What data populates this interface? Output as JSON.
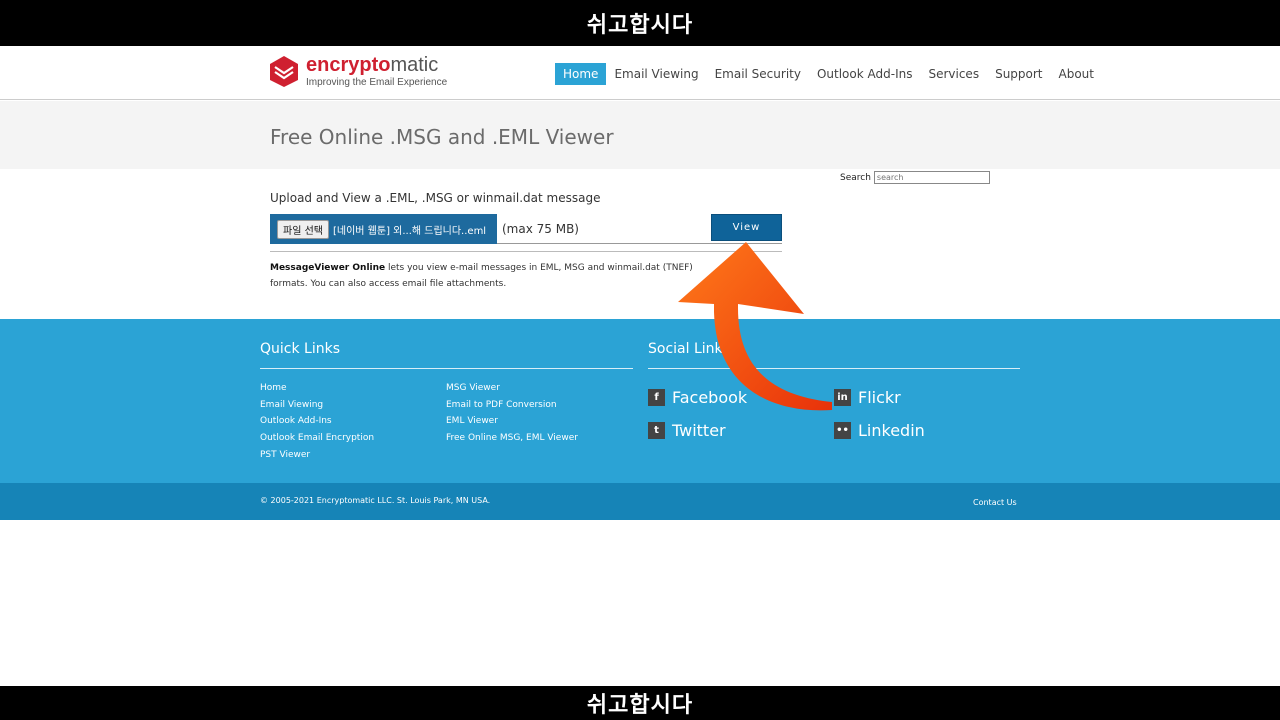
{
  "overlay": {
    "top_caption": "쉬고합시다",
    "bottom_caption": "쉬고합시다"
  },
  "logo": {
    "brand_part1": "encrypto",
    "brand_part2": "matic",
    "tagline": "Improving the Email Experience"
  },
  "nav": [
    {
      "label": "Home",
      "active": true
    },
    {
      "label": "Email Viewing"
    },
    {
      "label": "Email Security"
    },
    {
      "label": "Outlook Add-Ins"
    },
    {
      "label": "Services"
    },
    {
      "label": "Support"
    },
    {
      "label": "About"
    }
  ],
  "page": {
    "title": "Free Online .MSG and .EML Viewer"
  },
  "search": {
    "label": "Search",
    "placeholder": "search"
  },
  "upload": {
    "label": "Upload and View a .EML, .MSG or winmail.dat message",
    "file_button": "파일 선택",
    "file_name": "[네이버 웹툰] 외...해 드립니다..eml",
    "max_size": "(max 75 MB)",
    "view_button": "View"
  },
  "description": {
    "product": "MessageViewer Online",
    "text": " lets you view e-mail messages in EML, MSG and winmail.dat (TNEF) formats. You can also access email file attachments."
  },
  "footer": {
    "quick_links_title": "Quick Links",
    "quick_links_col1": [
      "Home",
      "Email Viewing",
      "Outlook Add-Ins",
      "Outlook Email Encryption",
      "PST Viewer"
    ],
    "quick_links_col2": [
      "MSG Viewer",
      "Email to PDF Conversion",
      "EML Viewer",
      "Free Online MSG, EML Viewer"
    ],
    "social_title": "Social Links",
    "social": [
      {
        "label": "Facebook",
        "icon": "facebook-icon",
        "glyph": "f"
      },
      {
        "label": "Twitter",
        "icon": "twitter-icon",
        "glyph": "t"
      },
      {
        "label": "Flickr",
        "icon": "linkedin-icon",
        "glyph": "in"
      },
      {
        "label": "Linkedin",
        "icon": "flickr-icon",
        "glyph": "••"
      }
    ],
    "copyright": "© 2005-2021 Encryptomatic LLC. St. Louis Park, MN USA.",
    "contact": "Contact Us"
  },
  "colors": {
    "accent": "#2ba3d5",
    "brand_red": "#cf2030",
    "button_blue": "#0f6399",
    "arrow": "#f04a10"
  }
}
